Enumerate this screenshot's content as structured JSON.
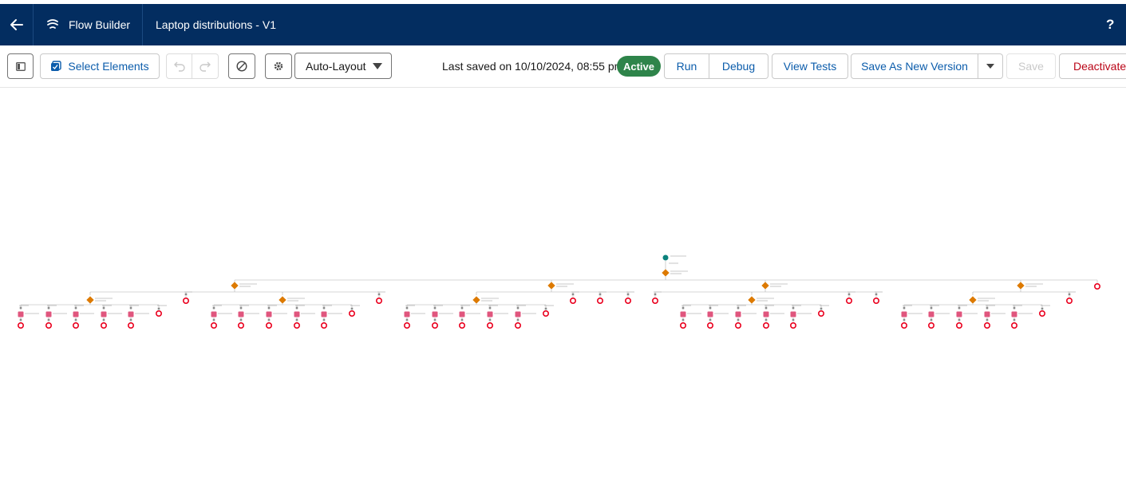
{
  "header": {
    "app_name": "Flow Builder",
    "flow_title": "Laptop distributions - V1",
    "help_label": "?",
    "icons": {
      "back": "back-arrow-icon",
      "app": "flow-builder-icon",
      "help": "help-icon"
    }
  },
  "toolbar": {
    "select_elements_label": "Select Elements",
    "layout_value": "Auto-Layout",
    "last_saved_text": "Last saved on 10/10/2024, 08:55 pm",
    "status_badge": "Active",
    "run_label": "Run",
    "debug_label": "Debug",
    "view_tests_label": "View Tests",
    "save_new_version_label": "Save As New Version",
    "save_label": "Save",
    "deactivate_label": "Deactivate",
    "icons": {
      "toggle_panel": "toggle-panel-icon",
      "select": "select-elements-icon",
      "undo": "undo-icon",
      "redo": "redo-icon",
      "errors": "no-errors-icon",
      "settings": "settings-gear-icon",
      "dropdown": "chevron-down-icon"
    }
  },
  "colors": {
    "header_bg": "#032d60",
    "brand_blue": "#0b5cab",
    "active_green": "#2e844a",
    "deactivate_red": "#ba0517",
    "decision_orange": "#dd7a01",
    "start_teal": "#0b827c",
    "end_red": "#ea001e",
    "action_pink": "#e0567e"
  },
  "canvas": {
    "description_mode": "auto-layout flow tree",
    "start_node": "start",
    "branches": 4,
    "decision_nodes": 9,
    "node_types": [
      "start",
      "decision",
      "action",
      "end"
    ]
  }
}
